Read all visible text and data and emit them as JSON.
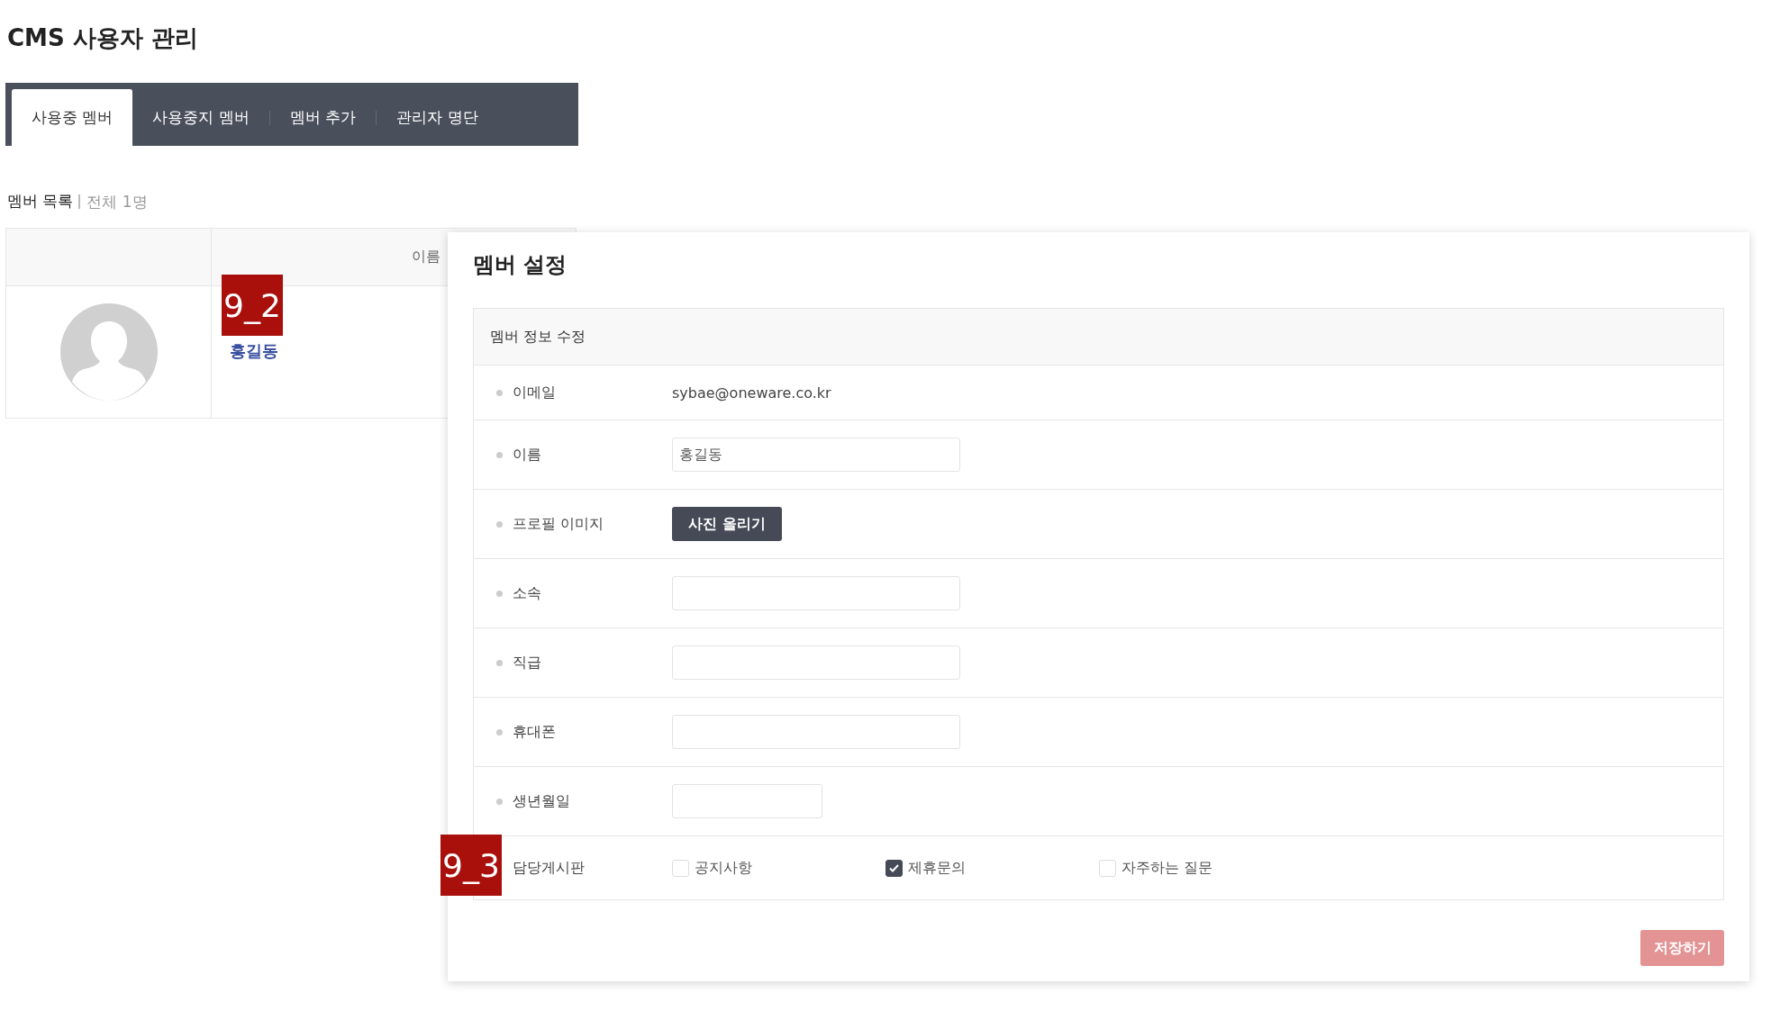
{
  "page_title": "CMS 사용자 관리",
  "tabs": [
    {
      "label": "사용중 멤버",
      "selected": true
    },
    {
      "label": "사용중지 멤버",
      "selected": false
    },
    {
      "label": "멤버 추가",
      "selected": false
    },
    {
      "label": "관리자 명단",
      "selected": false
    }
  ],
  "list_header": {
    "title": "멤버 목록",
    "count": "전체 1명"
  },
  "table": {
    "name_column": "이름",
    "rows": [
      {
        "name": "홍길동"
      }
    ]
  },
  "modal": {
    "title": "멤버 설정",
    "section_title": "멤버 정보 수정",
    "fields": [
      {
        "kind": "text",
        "bullet": true,
        "label": "이메일",
        "value": "sybae@oneware.co.kr"
      },
      {
        "kind": "input",
        "bullet": true,
        "label": "이름",
        "value": "홍길동"
      },
      {
        "kind": "upload",
        "bullet": true,
        "label": "프로필 이미지",
        "button": "사진 올리기"
      },
      {
        "kind": "input",
        "bullet": true,
        "label": "소속"
      },
      {
        "kind": "input",
        "bullet": true,
        "label": "직급"
      },
      {
        "kind": "input",
        "bullet": true,
        "label": "휴대폰"
      },
      {
        "kind": "short-input",
        "bullet": true,
        "label": "생년월일"
      },
      {
        "kind": "checkboxes",
        "bullet": false,
        "label": "담당게시판",
        "options": [
          {
            "label": "공지사항",
            "checked": false
          },
          {
            "label": "제휴문의",
            "checked": true
          },
          {
            "label": "자주하는 질문",
            "checked": false
          }
        ]
      }
    ],
    "save_button": "저장하기"
  },
  "annotations": [
    {
      "label": "9_2"
    },
    {
      "label": "9_3"
    }
  ]
}
